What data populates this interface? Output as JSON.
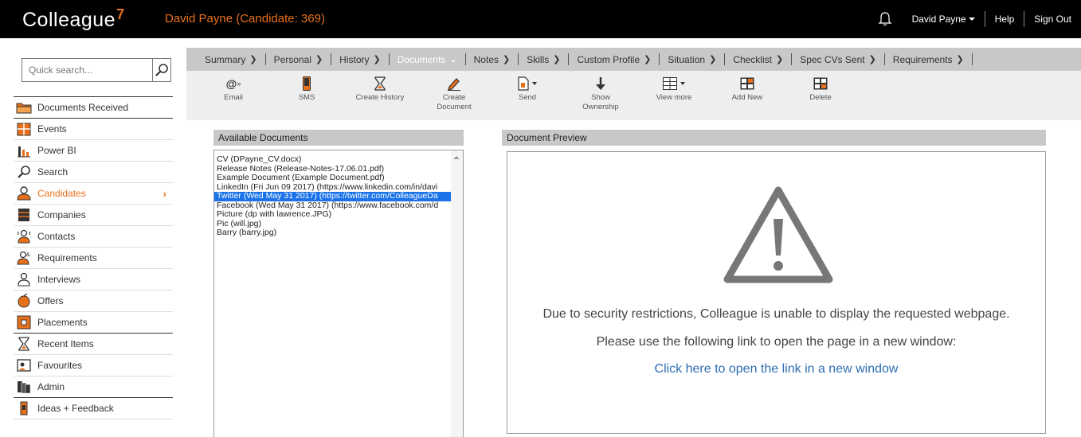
{
  "app": {
    "logo_text": "Colleague",
    "logo_version": "7"
  },
  "header": {
    "candidate_title": "David Payne (Candidate: 369)",
    "user_name": "David Payne",
    "help_label": "Help",
    "signout_label": "Sign Out"
  },
  "search": {
    "placeholder": "Quick search..."
  },
  "sidebar": {
    "items": [
      {
        "label": "Documents Received",
        "icon": "folder-icon"
      },
      {
        "label": "Events",
        "icon": "calendar-icon"
      },
      {
        "label": "Power BI",
        "icon": "bar-chart-icon"
      },
      {
        "label": "Search",
        "icon": "search-icon"
      },
      {
        "label": "Candidates",
        "icon": "person-icon",
        "active": true
      },
      {
        "label": "Companies",
        "icon": "building-icon"
      },
      {
        "label": "Contacts",
        "icon": "contact-icon"
      },
      {
        "label": "Requirements",
        "icon": "requirement-icon"
      },
      {
        "label": "Interviews",
        "icon": "interview-icon"
      },
      {
        "label": "Offers",
        "icon": "offer-icon"
      },
      {
        "label": "Placements",
        "icon": "placement-icon"
      },
      {
        "label": "Recent Items",
        "icon": "hourglass-icon"
      },
      {
        "label": "Favourites",
        "icon": "favourite-icon"
      },
      {
        "label": "Admin",
        "icon": "admin-icon"
      },
      {
        "label": "Ideas + Feedback",
        "icon": "feedback-icon"
      }
    ]
  },
  "tabs": [
    {
      "label": "Summary"
    },
    {
      "label": "Personal"
    },
    {
      "label": "History"
    },
    {
      "label": "Documents",
      "active": true
    },
    {
      "label": "Notes"
    },
    {
      "label": "Skills"
    },
    {
      "label": "Custom Profile"
    },
    {
      "label": "Situation"
    },
    {
      "label": "Checklist"
    },
    {
      "label": "Spec CVs Sent"
    },
    {
      "label": "Requirements"
    }
  ],
  "toolbar": {
    "email": "Email",
    "sms": "SMS",
    "create_history": "Create History",
    "create_document_1": "Create",
    "create_document_2": "Document",
    "send": "Send",
    "show_ownership_1": "Show",
    "show_ownership_2": "Ownership",
    "view_more": "View more",
    "add_new": "Add New",
    "delete": "Delete"
  },
  "documents": {
    "header": "Available Documents",
    "items": [
      "CV (DPayne_CV.docx)",
      "Release Notes (Release-Notes-17.06.01.pdf)",
      "Example Document (Example Document.pdf)",
      "LinkedIn (Fri Jun 09 2017) (https://www.linkedin.com/in/davi",
      "Twitter (Wed May 31 2017) (https://twitter.com/ColleagueDa",
      "Facebook (Wed May 31 2017) (https://www.facebook.com/d",
      "Picture (dp with lawrence.JPG)",
      "Pic (will.jpg)",
      "Barry (barry.jpg)"
    ],
    "selected_index": 4
  },
  "preview": {
    "header": "Document Preview",
    "message_line1": "Due to security restrictions, Colleague is unable to display the requested webpage.",
    "message_line2": "Please use the following link to open the page in a new window:",
    "link_text": "Click here to open the link in a new window"
  },
  "colors": {
    "accent": "#e8701a",
    "link": "#2e6db4",
    "selected": "#1a73e8"
  }
}
